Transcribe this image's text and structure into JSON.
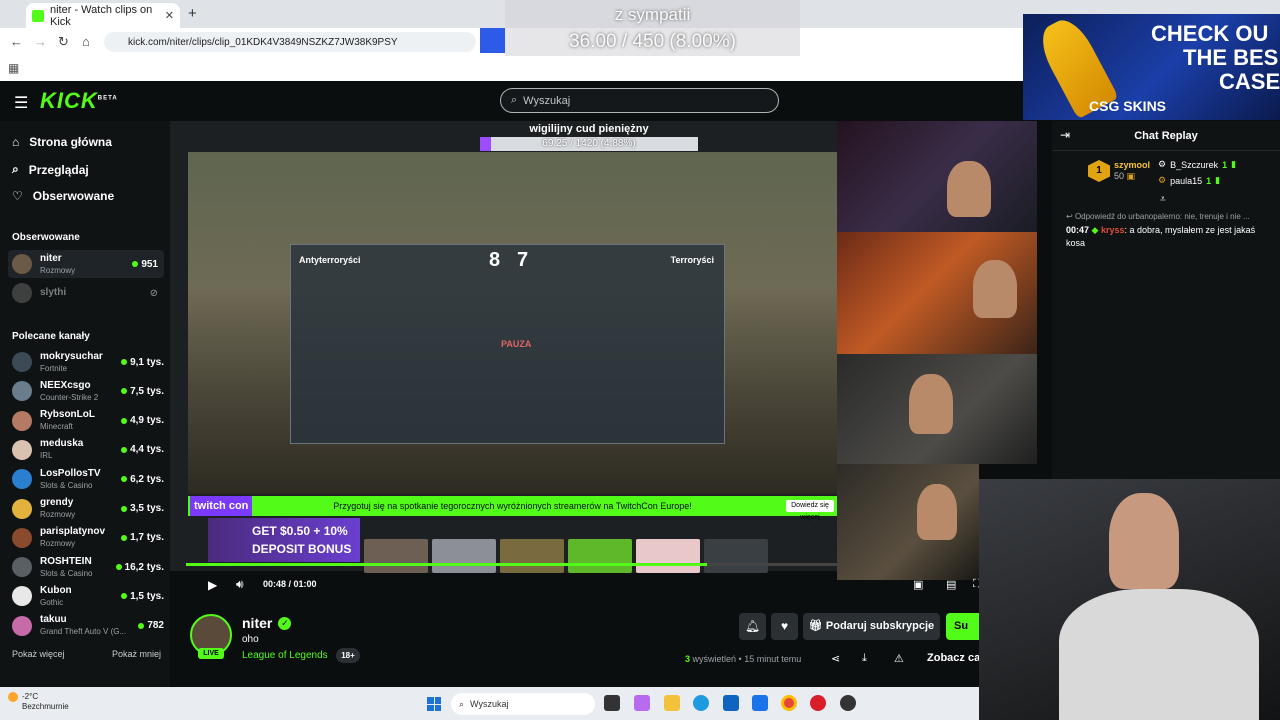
{
  "browser": {
    "tab_title": "niter - Watch clips on Kick",
    "url": "kick.com/niter/clips/clip_01KDK4V3849NSZKZ7JW38K9PSY"
  },
  "overlay": {
    "title": "z sympatii",
    "progress_text": "36.00 / 450 (8.00%)"
  },
  "ad": {
    "headline_1": "CHECK OU",
    "headline_2": "THE BES",
    "headline_3": "CASE",
    "brand": "CSG SKINS"
  },
  "kick": {
    "logo": "KICK",
    "logo_badge": "BETA",
    "search_placeholder": "Wyszukaj"
  },
  "sidebar": {
    "nav": [
      {
        "label": "Strona główna",
        "icon": "home-icon"
      },
      {
        "label": "Przeglądaj",
        "icon": "browse-icon"
      },
      {
        "label": "Obserwowane",
        "icon": "heart-icon"
      }
    ],
    "following_header": "Obserwowane",
    "following": [
      {
        "name": "niter",
        "category": "Rozmowy",
        "viewers": "951",
        "live": true
      },
      {
        "name": "slythi",
        "category": "",
        "viewers": "",
        "live": false
      }
    ],
    "recommended_header": "Polecane kanały",
    "recommended": [
      {
        "name": "mokrysuchar",
        "category": "Fortnite",
        "viewers": "9,1 tys.",
        "color": "#3c4a55"
      },
      {
        "name": "NEEXcsgo",
        "category": "Counter-Strike 2",
        "viewers": "7,5 tys.",
        "color": "#6a7d8c"
      },
      {
        "name": "RybsonLoL",
        "category": "Minecraft",
        "viewers": "4,9 tys.",
        "color": "#b57a63"
      },
      {
        "name": "meduska",
        "category": "IRL",
        "viewers": "4,4 tys.",
        "color": "#d9c2b0"
      },
      {
        "name": "LosPollosTV",
        "category": "Slots & Casino",
        "viewers": "6,2 tys.",
        "color": "#2b7fd1"
      },
      {
        "name": "grendy",
        "category": "Rozmowy",
        "viewers": "3,5 tys.",
        "color": "#e2b23c"
      },
      {
        "name": "parisplatynov",
        "category": "Rozmowy",
        "viewers": "1,7 tys.",
        "color": "#8a4a2e"
      },
      {
        "name": "ROSHTEIN",
        "category": "Slots & Casino",
        "viewers": "16,2 tys.",
        "color": "#5a5f66"
      },
      {
        "name": "Kubon",
        "category": "Gothic",
        "viewers": "1,5 tys.",
        "color": "#e8e8e8"
      },
      {
        "name": "takuu",
        "category": "Grand Theft Auto V (G...",
        "viewers": "782",
        "color": "#c76aa8"
      }
    ],
    "show_more": "Pokaż więcej",
    "show_less": "Pokaż mniej"
  },
  "video": {
    "goal_title": "wigilijny cud pieniężny",
    "goal_text": "69.25 / 1420 (4.88%)",
    "goal_fraction": 0.0488,
    "score_ct_label": "Antyterroryści",
    "score_t_label": "Terroryści",
    "score_ct": "8",
    "score_t": "7",
    "pause_label": "PAUZA",
    "banner_text": "Przygotuj się na spotkanie tegorocznych wyróżnionych streamerów na TwitchCon Europe!",
    "banner_button": "Dowiedz się więcej",
    "twitchcon": "twitch con",
    "deposit_1": "GET $0.50 + 10%",
    "deposit_2": "DEPOSIT BONUS",
    "time_current": "00:48",
    "time_total": "01:00",
    "played_fraction": 0.8
  },
  "chat": {
    "title": "Chat Replay",
    "gifter": {
      "rank": "1",
      "name": "szymool",
      "count": "50"
    },
    "gift_lines": [
      {
        "name": "B_Szczurek",
        "count": "1"
      },
      {
        "name": "paula15",
        "count": "1"
      }
    ],
    "reply_to": "Odpowiedź do urbanopalerno: nie, trenuje i nie ...",
    "message": {
      "time": "00:47",
      "user": "kryss",
      "text": "a dobra, myslałem ze jest jakaś kosa"
    }
  },
  "channel": {
    "name": "niter",
    "clip_title": "oho",
    "category": "League of Legends",
    "age_rating": "18+",
    "live_label": "LIVE",
    "subscribe_label": "Podaruj subskrypcje",
    "follow_label": "Su",
    "views_count": "3",
    "views_label": "wyświetleń",
    "time_ago": "15 minut temu",
    "view_all_label": "Zobacz ca"
  },
  "taskbar": {
    "weather_temp": "-2°C",
    "weather_desc": "Bezchmurnie",
    "search_placeholder": "Wyszukaj"
  }
}
